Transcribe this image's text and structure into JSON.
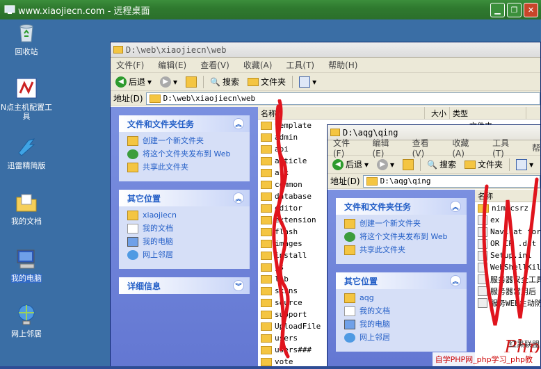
{
  "remote_desktop": {
    "title": "www.xiaojiecn.com - 远程桌面"
  },
  "desktop_icons": [
    {
      "label": "回收站",
      "icon": "recycle-bin-icon"
    },
    {
      "label": "N点主机配置工具",
      "icon": "n-host-config-icon"
    },
    {
      "label": "迅雷精简版",
      "icon": "thunder-icon"
    },
    {
      "label": "我的文档",
      "icon": "my-documents-icon"
    },
    {
      "label": "我的电脑",
      "icon": "my-computer-icon"
    },
    {
      "label": "网上邻居",
      "icon": "network-neighborhood-icon"
    }
  ],
  "window_back": {
    "title": "D:\\web\\xiaojiecn\\web",
    "menu": [
      "文件(F)",
      "编辑(E)",
      "查看(V)",
      "收藏(A)",
      "工具(T)",
      "帮助(H)"
    ],
    "toolbar": {
      "back": "后退",
      "search": "搜索",
      "folders": "文件夹"
    },
    "address_label": "地址(D)",
    "address": "D:\\web\\xiaojiecn\\web",
    "tasks_title": "文件和文件夹任务",
    "tasks": [
      "创建一个新文件夹",
      "将这个文件夹发布到 Web",
      "共享此文件夹"
    ],
    "places_title": "其它位置",
    "places": [
      "xiaojiecn",
      "我的文档",
      "我的电脑",
      "网上邻居"
    ],
    "details_title": "详细信息",
    "columns": {
      "name": "名称",
      "size": "大小",
      "type": "类型"
    },
    "type_cell": "文件夹",
    "files": [
      "template",
      "admin",
      "api",
      "article",
      "ask",
      "common",
      "database",
      "editor",
      "extension",
      "flash",
      "images",
      "install",
      "js",
      "lib",
      "skins",
      "source",
      "support",
      "UploadFile",
      "users",
      "users###",
      "vote"
    ]
  },
  "window_front": {
    "title": "D:\\aqg\\qing",
    "menu": [
      "文件(F)",
      "编辑(E)",
      "查看(V)",
      "收藏(A)",
      "工具(T)",
      "帮"
    ],
    "toolbar": {
      "back": "后退",
      "search": "搜索",
      "folders": "文件夹"
    },
    "address_label": "地址(D)",
    "address": "D:\\aqg\\qing",
    "tasks_title": "文件和文件夹任务",
    "tasks": [
      "创建一个新文件夹",
      "将这个文件夹发布到 Web",
      "共享此文件夹"
    ],
    "places_title": "其它位置",
    "places": [
      "aqg",
      "我的文档",
      "我的电脑",
      "网上邻居"
    ],
    "columns": {
      "name": "名称"
    },
    "files": [
      "nimicsrz",
      "ex",
      "Navicat for S",
      "OR CR .dat",
      "Setup.ini",
      "WebShellKill",
      "服务器安全工具",
      "服务器常用后",
      "服务WEB主动防"
    ]
  },
  "watermark": {
    "brand": "Php",
    "sub": "红黑联盟",
    "footer": "自学PHP网_php学习_php教"
  }
}
